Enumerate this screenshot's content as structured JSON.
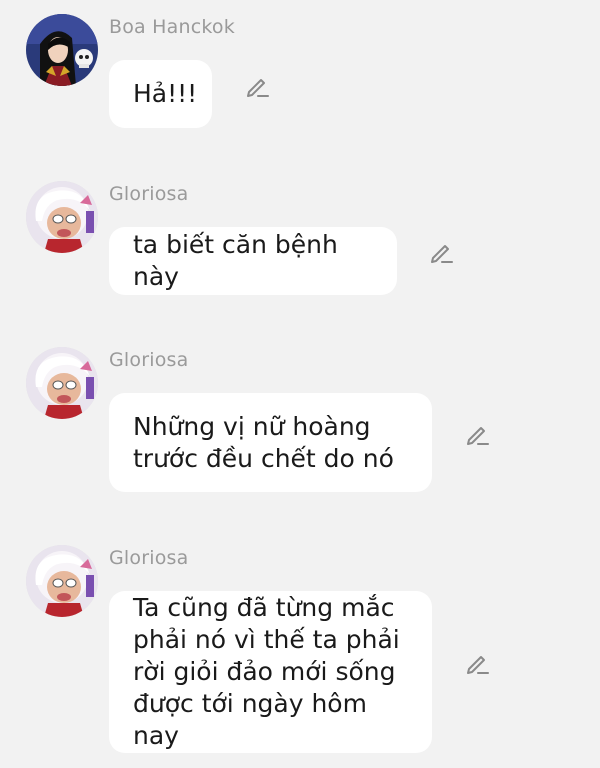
{
  "messages": [
    {
      "sender": "Boa Hanckok",
      "text": "Hả!!!",
      "avatar_icon": "boa-hancock-avatar",
      "action_icon": "pencil-edit-icon"
    },
    {
      "sender": "Gloriosa",
      "text": "ta biết căn bệnh này",
      "avatar_icon": "gloriosa-avatar",
      "action_icon": "pencil-edit-icon"
    },
    {
      "sender": "Gloriosa",
      "text": "Những vị nữ hoàng\ntrước đều chết do nó",
      "avatar_icon": "gloriosa-avatar",
      "action_icon": "pencil-edit-icon"
    },
    {
      "sender": "Gloriosa",
      "text": "Ta cũng đã từng mắc\nphải nó vì thế ta phải\nrời giỏi đảo mới sống\nđược tới ngày hôm nay",
      "avatar_icon": "gloriosa-avatar",
      "action_icon": "pencil-edit-icon"
    }
  ],
  "colors": {
    "background": "#f2f2f2",
    "bubble": "#ffffff",
    "sender_text": "#9a9a9a",
    "message_text": "#1a1a1a"
  }
}
